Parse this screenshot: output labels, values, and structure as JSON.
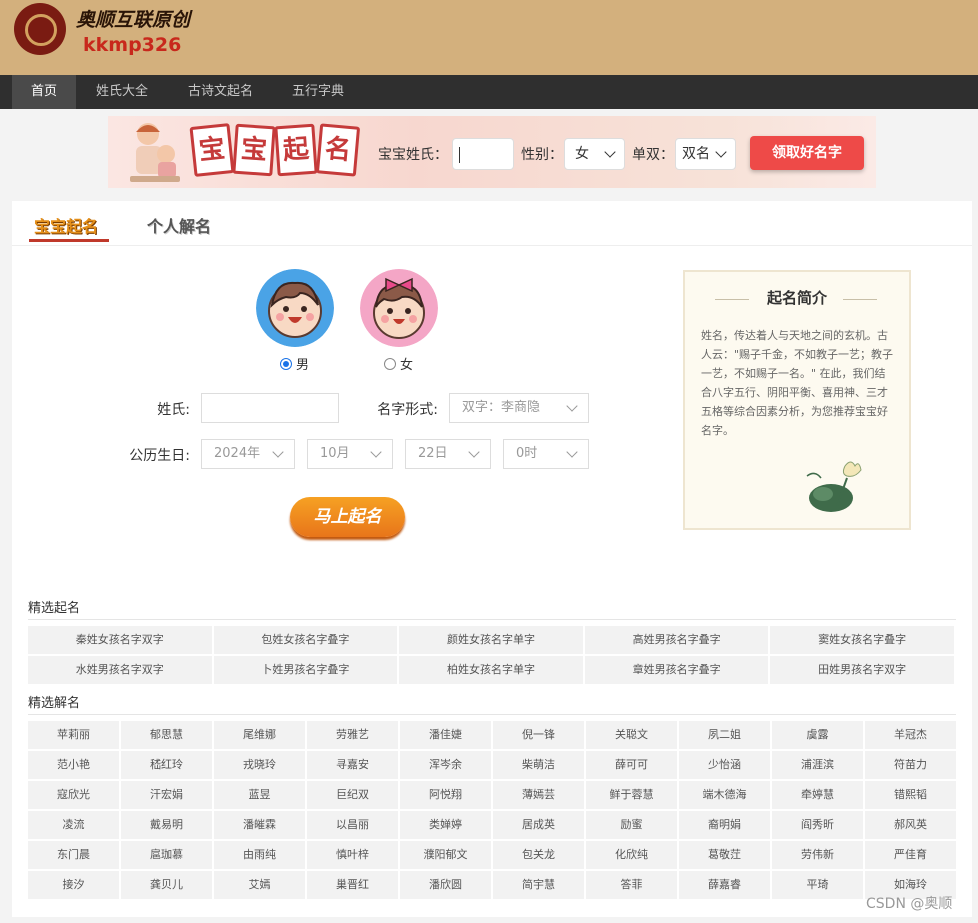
{
  "header": {
    "brand": "奥顺互联原创",
    "subtitle": "kkmp326"
  },
  "nav": {
    "items": [
      "首页",
      "姓氏大全",
      "古诗文起名",
      "五行字典"
    ]
  },
  "banner": {
    "tiles": [
      "宝",
      "宝",
      "起",
      "名"
    ],
    "surname_label": "宝宝姓氏：",
    "gender_label": "性别：",
    "gender_value": "女",
    "type_label": "单双：",
    "type_value": "双名",
    "cta": "领取好名字"
  },
  "tabs": [
    "宝宝起名",
    "个人解名"
  ],
  "gender": {
    "male": "男",
    "female": "女"
  },
  "form": {
    "surname_label": "姓氏:",
    "name_type_label": "名字形式:",
    "name_type_value": "双字：李商隐",
    "birth_label": "公历生日:",
    "year": "2024年",
    "month": "10月",
    "day": "22日",
    "hour": "0时",
    "submit": "马上起名"
  },
  "intro": {
    "title": "起名简介",
    "text": "姓名，传达着人与天地之间的玄机。古人云：\"赐子千金，不如教子一艺；教子一艺，不如赐子一名。\" 在此，我们结合八字五行、阴阳平衡、喜用神、三才五格等综合因素分析，为您推荐宝宝好名字。"
  },
  "selected_names": {
    "title": "精选起名",
    "items": [
      "秦姓女孩名字双字",
      "包姓女孩名字叠字",
      "颜姓女孩名字单字",
      "高姓男孩名字叠字",
      "窦姓女孩名字叠字",
      "水姓男孩名字双字",
      "卜姓男孩名字叠字",
      "柏姓女孩名字单字",
      "章姓男孩名字叠字",
      "田姓男孩名字双字"
    ]
  },
  "selected_interp": {
    "title": "精选解名",
    "items": [
      "苹莉丽",
      "郁思慧",
      "尾维娜",
      "劳雅艺",
      "潘佳婕",
      "倪一锋",
      "关聪文",
      "夙二姐",
      "虞露",
      "羊冠杰",
      "范小艳",
      "嵇红玲",
      "戎晓玲",
      "寻嘉安",
      "浑岑余",
      "柴萌洁",
      "薛可可",
      "少怡涵",
      "浦涯滨",
      "符苗力",
      "寇欣光",
      "汗宏娟",
      "蓝昱",
      "巨纪双",
      "阿悦翔",
      "薄嫣芸",
      "鲜于蓉慧",
      "端木德海",
      "牵婷慧",
      "错熙韬",
      "凌流",
      "戴易明",
      "潘皠霖",
      "以昌丽",
      "类婵婷",
      "居成英",
      "励蜜",
      "裔明娟",
      "阎秀昕",
      "郝风英",
      "东门晨",
      "扈珈慕",
      "由雨纯",
      "慎叶梓",
      "濮阳郁文",
      "包关龙",
      "化欣纯",
      "葛敬茳",
      "劳伟新",
      "严佳育",
      "接汐",
      "龚贝儿",
      "艾嫣",
      "巢晋红",
      "潘欣圆",
      "简宇慧",
      "答菲",
      "薛嘉睿",
      "平琦",
      "如海玲"
    ]
  },
  "watermark": "CSDN @奥顺"
}
